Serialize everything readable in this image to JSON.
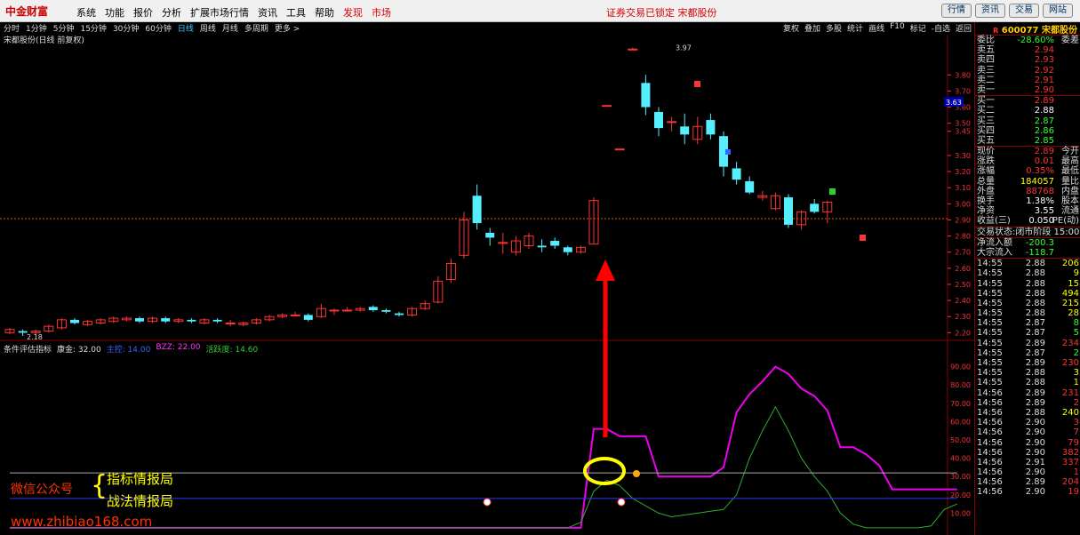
{
  "app": {
    "logo": "中金财富"
  },
  "menu": [
    {
      "label": "系统"
    },
    {
      "label": "功能"
    },
    {
      "label": "报价"
    },
    {
      "label": "分析"
    },
    {
      "label": "扩展市场行情"
    },
    {
      "label": "资讯"
    },
    {
      "label": "工具"
    },
    {
      "label": "帮助"
    },
    {
      "label": "发现"
    },
    {
      "label": "市场"
    }
  ],
  "notice": "证券交易已锁定 宋都股份",
  "top_buttons": [
    {
      "label": "行情"
    },
    {
      "label": "资讯"
    },
    {
      "label": "交易"
    },
    {
      "label": "网站"
    }
  ],
  "periods": [
    {
      "label": "分时"
    },
    {
      "label": "1分钟"
    },
    {
      "label": "5分钟"
    },
    {
      "label": "15分钟"
    },
    {
      "label": "30分钟"
    },
    {
      "label": "60分钟"
    },
    {
      "label": "日线"
    },
    {
      "label": "周线"
    },
    {
      "label": "月线"
    },
    {
      "label": "多周期"
    },
    {
      "label": "更多 >"
    }
  ],
  "toolbar": [
    {
      "label": "复权"
    },
    {
      "label": "叠加"
    },
    {
      "label": "多股"
    },
    {
      "label": "统计"
    },
    {
      "label": "画线"
    },
    {
      "label": "F10"
    },
    {
      "label": "标记"
    },
    {
      "label": "-自选"
    },
    {
      "label": "返回"
    }
  ],
  "chart_title": "宋都股份(日线 前复权)",
  "price_axis": [
    "3.80",
    "3.70",
    "3.60",
    "3.50",
    "3.45",
    "3.30",
    "3.20",
    "3.10",
    "3.00",
    "2.90",
    "2.80",
    "2.70",
    "2.60",
    "2.50",
    "2.40",
    "2.30",
    "2.20"
  ],
  "high_label": "3.97",
  "low_label": "2.18",
  "cursor_price": "3.63",
  "indicator": {
    "name": "条件评估指标",
    "items": [
      {
        "label": "康金: 32.00",
        "color": "#ddd"
      },
      {
        "label": "主控: 14.00",
        "color": "#36f"
      },
      {
        "label": "BZZ: 22.00",
        "color": "#f3f"
      },
      {
        "label": "活跃度: 14.60",
        "color": "#3c3"
      }
    ]
  },
  "ind_axis": [
    "90.00",
    "80.00",
    "70.00",
    "60.00",
    "50.00",
    "40.00",
    "30.00",
    "20.00",
    "10.00"
  ],
  "watermark": {
    "line1": "微信公众号",
    "line2": "指标情报局",
    "line3": "战法情报局",
    "url": "www.zhibiao168.com"
  },
  "panel": {
    "code": "600077",
    "name": "宋都股份",
    "weibi": {
      "label": "委比",
      "value": "-28.60%",
      "right": "委差"
    },
    "asks": [
      {
        "label": "卖五",
        "price": "2.94"
      },
      {
        "label": "卖四",
        "price": "2.93"
      },
      {
        "label": "卖三",
        "price": "2.92"
      },
      {
        "label": "卖二",
        "price": "2.91"
      },
      {
        "label": "卖一",
        "price": "2.90"
      }
    ],
    "bids": [
      {
        "label": "买一",
        "price": "2.89"
      },
      {
        "label": "买二",
        "price": "2.88"
      },
      {
        "label": "买三",
        "price": "2.87"
      },
      {
        "label": "买四",
        "price": "2.86"
      },
      {
        "label": "买五",
        "price": "2.85"
      }
    ],
    "stats": [
      {
        "label": "现价",
        "value": "2.89",
        "right": "今开",
        "color": "red"
      },
      {
        "label": "涨跌",
        "value": "0.01",
        "right": "最高",
        "color": "red"
      },
      {
        "label": "涨幅",
        "value": "0.35%",
        "right": "最低",
        "color": "red"
      },
      {
        "label": "总量",
        "value": "184057",
        "right": "量比",
        "color": "yellow"
      },
      {
        "label": "外盘",
        "value": "88768",
        "right": "内盘",
        "color": "red"
      },
      {
        "label": "换手",
        "value": "1.38%",
        "right": "股本",
        "color": "white"
      },
      {
        "label": "净资",
        "value": "3.55",
        "right": "流通",
        "color": "white"
      },
      {
        "label": "收益(三)",
        "value": "0.050",
        "right": "PE(动)",
        "color": "white"
      }
    ],
    "status": "交易状态:闭市阶段 15:00",
    "flows": [
      {
        "label": "净流入额",
        "value": "-200.3"
      },
      {
        "label": "大宗流入",
        "value": "-118.7"
      }
    ],
    "trades": [
      {
        "t": "14:55",
        "p": "2.88",
        "v": "206",
        "c": "white",
        "vc": "yellow"
      },
      {
        "t": "14:55",
        "p": "2.88",
        "v": "9",
        "c": "white",
        "vc": "yellow"
      },
      {
        "t": "14:55",
        "p": "2.88",
        "v": "15",
        "c": "white",
        "vc": "yellow"
      },
      {
        "t": "14:55",
        "p": "2.88",
        "v": "494",
        "c": "white",
        "vc": "yellow"
      },
      {
        "t": "14:55",
        "p": "2.88",
        "v": "215",
        "c": "white",
        "vc": "yellow"
      },
      {
        "t": "14:55",
        "p": "2.88",
        "v": "28",
        "c": "white",
        "vc": "yellow"
      },
      {
        "t": "14:55",
        "p": "2.87",
        "v": "8",
        "c": "green",
        "vc": "green"
      },
      {
        "t": "14:55",
        "p": "2.87",
        "v": "5",
        "c": "green",
        "vc": "green"
      },
      {
        "t": "14:55",
        "p": "2.89",
        "v": "234",
        "c": "red",
        "vc": "red"
      },
      {
        "t": "14:55",
        "p": "2.87",
        "v": "2",
        "c": "green",
        "vc": "green"
      },
      {
        "t": "14:55",
        "p": "2.89",
        "v": "230",
        "c": "red",
        "vc": "red"
      },
      {
        "t": "14:55",
        "p": "2.88",
        "v": "3",
        "c": "white",
        "vc": "yellow"
      },
      {
        "t": "14:55",
        "p": "2.88",
        "v": "1",
        "c": "white",
        "vc": "yellow"
      },
      {
        "t": "14:56",
        "p": "2.89",
        "v": "231",
        "c": "red",
        "vc": "red"
      },
      {
        "t": "14:56",
        "p": "2.89",
        "v": "2",
        "c": "red",
        "vc": "red"
      },
      {
        "t": "14:56",
        "p": "2.88",
        "v": "240",
        "c": "white",
        "vc": "yellow"
      },
      {
        "t": "14:56",
        "p": "2.90",
        "v": "3",
        "c": "red",
        "vc": "red"
      },
      {
        "t": "14:56",
        "p": "2.90",
        "v": "7",
        "c": "red",
        "vc": "red"
      },
      {
        "t": "14:56",
        "p": "2.90",
        "v": "79",
        "c": "red",
        "vc": "red"
      },
      {
        "t": "14:56",
        "p": "2.90",
        "v": "382",
        "c": "red",
        "vc": "red"
      },
      {
        "t": "14:56",
        "p": "2.91",
        "v": "337",
        "c": "red",
        "vc": "red"
      },
      {
        "t": "14:56",
        "p": "2.90",
        "v": "1",
        "c": "red",
        "vc": "red"
      },
      {
        "t": "14:56",
        "p": "2.89",
        "v": "204",
        "c": "red",
        "vc": "red"
      },
      {
        "t": "14:56",
        "p": "2.90",
        "v": "19",
        "c": "red",
        "vc": "red"
      }
    ]
  },
  "chart_data": {
    "type": "candlestick",
    "candles": [
      {
        "o": 2.2,
        "c": 2.22,
        "h": 2.23,
        "l": 2.19
      },
      {
        "o": 2.21,
        "c": 2.2,
        "h": 2.22,
        "l": 2.18
      },
      {
        "o": 2.2,
        "c": 2.21,
        "h": 2.22,
        "l": 2.19
      },
      {
        "o": 2.21,
        "c": 2.24,
        "h": 2.25,
        "l": 2.2
      },
      {
        "o": 2.23,
        "c": 2.28,
        "h": 2.29,
        "l": 2.22
      },
      {
        "o": 2.28,
        "c": 2.26,
        "h": 2.29,
        "l": 2.25
      },
      {
        "o": 2.25,
        "c": 2.27,
        "h": 2.28,
        "l": 2.24
      },
      {
        "o": 2.26,
        "c": 2.28,
        "h": 2.29,
        "l": 2.25
      },
      {
        "o": 2.27,
        "c": 2.29,
        "h": 2.3,
        "l": 2.26
      },
      {
        "o": 2.28,
        "c": 2.29,
        "h": 2.3,
        "l": 2.27
      },
      {
        "o": 2.29,
        "c": 2.27,
        "h": 2.3,
        "l": 2.26
      },
      {
        "o": 2.27,
        "c": 2.29,
        "h": 2.3,
        "l": 2.26
      },
      {
        "o": 2.29,
        "c": 2.27,
        "h": 2.3,
        "l": 2.26
      },
      {
        "o": 2.27,
        "c": 2.28,
        "h": 2.29,
        "l": 2.26
      },
      {
        "o": 2.28,
        "c": 2.27,
        "h": 2.29,
        "l": 2.26
      },
      {
        "o": 2.26,
        "c": 2.28,
        "h": 2.29,
        "l": 2.25
      },
      {
        "o": 2.28,
        "c": 2.27,
        "h": 2.29,
        "l": 2.26
      },
      {
        "o": 2.26,
        "c": 2.26,
        "h": 2.28,
        "l": 2.24
      },
      {
        "o": 2.25,
        "c": 2.26,
        "h": 2.27,
        "l": 2.24
      },
      {
        "o": 2.26,
        "c": 2.28,
        "h": 2.29,
        "l": 2.25
      },
      {
        "o": 2.28,
        "c": 2.3,
        "h": 2.31,
        "l": 2.27
      },
      {
        "o": 2.3,
        "c": 2.31,
        "h": 2.32,
        "l": 2.29
      },
      {
        "o": 2.31,
        "c": 2.31,
        "h": 2.33,
        "l": 2.3
      },
      {
        "o": 2.31,
        "c": 2.28,
        "h": 2.32,
        "l": 2.27
      },
      {
        "o": 2.3,
        "c": 2.35,
        "h": 2.38,
        "l": 2.29
      },
      {
        "o": 2.34,
        "c": 2.34,
        "h": 2.35,
        "l": 2.31
      },
      {
        "o": 2.34,
        "c": 2.34,
        "h": 2.36,
        "l": 2.33
      },
      {
        "o": 2.34,
        "c": 2.35,
        "h": 2.36,
        "l": 2.33
      },
      {
        "o": 2.36,
        "c": 2.34,
        "h": 2.37,
        "l": 2.33
      },
      {
        "o": 2.34,
        "c": 2.33,
        "h": 2.35,
        "l": 2.32
      },
      {
        "o": 2.32,
        "c": 2.31,
        "h": 2.33,
        "l": 2.3
      },
      {
        "o": 2.31,
        "c": 2.35,
        "h": 2.36,
        "l": 2.3
      },
      {
        "o": 2.35,
        "c": 2.38,
        "h": 2.4,
        "l": 2.34
      },
      {
        "o": 2.39,
        "c": 2.52,
        "h": 2.55,
        "l": 2.38
      },
      {
        "o": 2.53,
        "c": 2.63,
        "h": 2.66,
        "l": 2.51
      },
      {
        "o": 2.68,
        "c": 2.9,
        "h": 2.95,
        "l": 2.66
      },
      {
        "o": 3.05,
        "c": 2.88,
        "h": 3.12,
        "l": 2.84
      },
      {
        "o": 2.82,
        "c": 2.79,
        "h": 2.85,
        "l": 2.74
      },
      {
        "o": 2.76,
        "c": 2.76,
        "h": 2.82,
        "l": 2.69
      },
      {
        "o": 2.7,
        "c": 2.77,
        "h": 2.8,
        "l": 2.68
      },
      {
        "o": 2.74,
        "c": 2.8,
        "h": 2.82,
        "l": 2.72
      },
      {
        "o": 2.74,
        "c": 2.73,
        "h": 2.78,
        "l": 2.7
      },
      {
        "o": 2.77,
        "c": 2.74,
        "h": 2.79,
        "l": 2.72
      },
      {
        "o": 2.73,
        "c": 2.7,
        "h": 2.74,
        "l": 2.68
      },
      {
        "o": 2.7,
        "c": 2.73,
        "h": 2.74,
        "l": 2.69
      },
      {
        "o": 2.75,
        "c": 3.02,
        "h": 3.04,
        "l": 2.75
      },
      {
        "o": 3.61,
        "c": 3.61,
        "h": 3.61,
        "l": 3.61
      },
      {
        "o": 3.34,
        "c": 3.34,
        "h": 3.34,
        "l": 3.34
      },
      {
        "o": 3.96,
        "c": 3.96,
        "h": 3.97,
        "l": 3.96
      },
      {
        "o": 3.75,
        "c": 3.6,
        "h": 3.8,
        "l": 3.55
      },
      {
        "o": 3.57,
        "c": 3.47,
        "h": 3.6,
        "l": 3.42
      },
      {
        "o": 3.51,
        "c": 3.51,
        "h": 3.54,
        "l": 3.45
      },
      {
        "o": 3.48,
        "c": 3.43,
        "h": 3.56,
        "l": 3.37
      },
      {
        "o": 3.4,
        "c": 3.48,
        "h": 3.54,
        "l": 3.37
      },
      {
        "o": 3.52,
        "c": 3.43,
        "h": 3.56,
        "l": 3.4
      },
      {
        "o": 3.42,
        "c": 3.23,
        "h": 3.45,
        "l": 3.17
      },
      {
        "o": 3.22,
        "c": 3.15,
        "h": 3.26,
        "l": 3.12
      },
      {
        "o": 3.14,
        "c": 3.07,
        "h": 3.17,
        "l": 3.06
      },
      {
        "o": 3.04,
        "c": 3.05,
        "h": 3.08,
        "l": 3.02
      },
      {
        "o": 2.97,
        "c": 3.05,
        "h": 3.07,
        "l": 2.96
      },
      {
        "o": 3.04,
        "c": 2.87,
        "h": 3.06,
        "l": 2.85
      },
      {
        "o": 2.87,
        "c": 2.95,
        "h": 2.96,
        "l": 2.84
      },
      {
        "o": 3.0,
        "c": 2.95,
        "h": 3.03,
        "l": 2.94
      },
      {
        "o": 2.95,
        "c": 3.01,
        "h": 3.02,
        "l": 2.88
      }
    ],
    "ylim": [
      2.18,
      4.0
    ],
    "ind_series": [
      {
        "name": "BZZ",
        "color": "#e0e",
        "values": [
          2,
          2,
          2,
          2,
          2,
          2,
          2,
          2,
          2,
          2,
          2,
          2,
          2,
          2,
          2,
          2,
          2,
          2,
          2,
          2,
          2,
          2,
          2,
          2,
          2,
          2,
          2,
          2,
          2,
          2,
          2,
          2,
          2,
          2,
          2,
          2,
          2,
          2,
          2,
          2,
          2,
          2,
          2,
          2,
          2,
          56,
          56,
          52,
          52,
          52,
          30,
          30,
          30,
          30,
          30,
          35,
          65,
          75,
          82,
          90,
          86,
          78,
          74,
          66,
          46,
          46,
          42,
          36,
          23,
          23,
          23,
          23,
          23,
          23
        ]
      },
      {
        "name": "活跃度",
        "color": "#3a3",
        "values": [
          2,
          2,
          2,
          2,
          2,
          2,
          2,
          2,
          2,
          2,
          2,
          2,
          2,
          2,
          2,
          2,
          2,
          2,
          2,
          2,
          2,
          2,
          2,
          2,
          2,
          2,
          2,
          2,
          2,
          2,
          2,
          2,
          2,
          2,
          2,
          2,
          2,
          2,
          2,
          2,
          2,
          2,
          2,
          2,
          5,
          22,
          28,
          25,
          18,
          14,
          10,
          8,
          9,
          10,
          11,
          12,
          20,
          40,
          55,
          68,
          55,
          40,
          30,
          22,
          10,
          4,
          2,
          2,
          2,
          2,
          2,
          3,
          12,
          15
        ]
      },
      {
        "name": "主控",
        "color": "#33f",
        "values": [
          18,
          18,
          18,
          18,
          18,
          18,
          18,
          18,
          18,
          18,
          18,
          18,
          18,
          18,
          18,
          18,
          18,
          18,
          18,
          18,
          18,
          18,
          18,
          18,
          18,
          18,
          18,
          18,
          18,
          18,
          18,
          18,
          18,
          18,
          18,
          18,
          18,
          18,
          18,
          18,
          18,
          18,
          18,
          18,
          18,
          18,
          18,
          18,
          18,
          18,
          18,
          18,
          18,
          18,
          18,
          18,
          18,
          18,
          18,
          18,
          18,
          18,
          18,
          18,
          18,
          18,
          18,
          18,
          18,
          18,
          18,
          18,
          18,
          18
        ]
      },
      {
        "name": "康金",
        "color": "#aaa",
        "values": [
          32,
          32,
          32,
          32,
          32,
          32,
          32,
          32,
          32,
          32,
          32,
          32,
          32,
          32,
          32,
          32,
          32,
          32,
          32,
          32,
          32,
          32,
          32,
          32,
          32,
          32,
          32,
          32,
          32,
          32,
          32,
          32,
          32,
          32,
          32,
          32,
          32,
          32,
          32,
          32,
          32,
          32,
          32,
          32,
          32,
          32,
          32,
          32,
          32,
          32,
          32,
          32,
          32,
          32,
          32,
          32,
          32,
          32,
          32,
          32,
          32,
          32,
          32,
          32,
          32,
          32,
          32,
          32,
          32,
          32,
          32,
          32,
          32,
          32
        ]
      }
    ],
    "ind_ylim": [
      0,
      100
    ]
  }
}
